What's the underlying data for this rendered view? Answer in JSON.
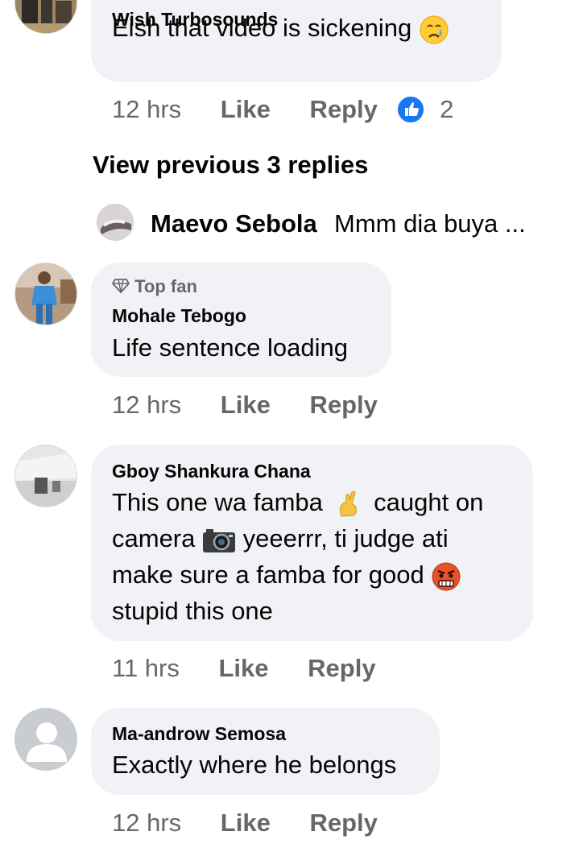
{
  "comments": [
    {
      "author": "Wish Turbosounds",
      "lines": [
        "Eish that video is sickening"
      ],
      "emoji": "crying-face",
      "time": "12 hrs",
      "like_label": "Like",
      "reply_label": "Reply",
      "reaction_count": "2"
    },
    {
      "badge": "Top fan",
      "author": "Mohale Tebogo",
      "lines": [
        "Life sentence loading"
      ],
      "time": "12 hrs",
      "like_label": "Like",
      "reply_label": "Reply"
    },
    {
      "author": "Gboy Shankura Chana",
      "segments": {
        "l1a": "This one wa famba",
        "l1b": "caught on",
        "l2a": "camera",
        "l2b": "yeeerrr, ti judge ati",
        "l3a": "make sure a famba for good",
        "l4": "stupid this one"
      },
      "emojis": [
        "crossed-fingers",
        "camera",
        "angry-face"
      ],
      "time": "11 hrs",
      "like_label": "Like",
      "reply_label": "Reply"
    },
    {
      "author": "Ma-androw Semosa",
      "lines": [
        "Exactly where he belongs"
      ],
      "time": "12 hrs",
      "like_label": "Like",
      "reply_label": "Reply"
    }
  ],
  "view_previous": "View previous 3 replies",
  "reply_preview": {
    "author": "Maevo Sebola",
    "text": "Mmm dia buya ..."
  },
  "colors": {
    "bubble": "#f0f2f5",
    "meta_text": "#65676b",
    "like_blue": "#1877f2"
  }
}
